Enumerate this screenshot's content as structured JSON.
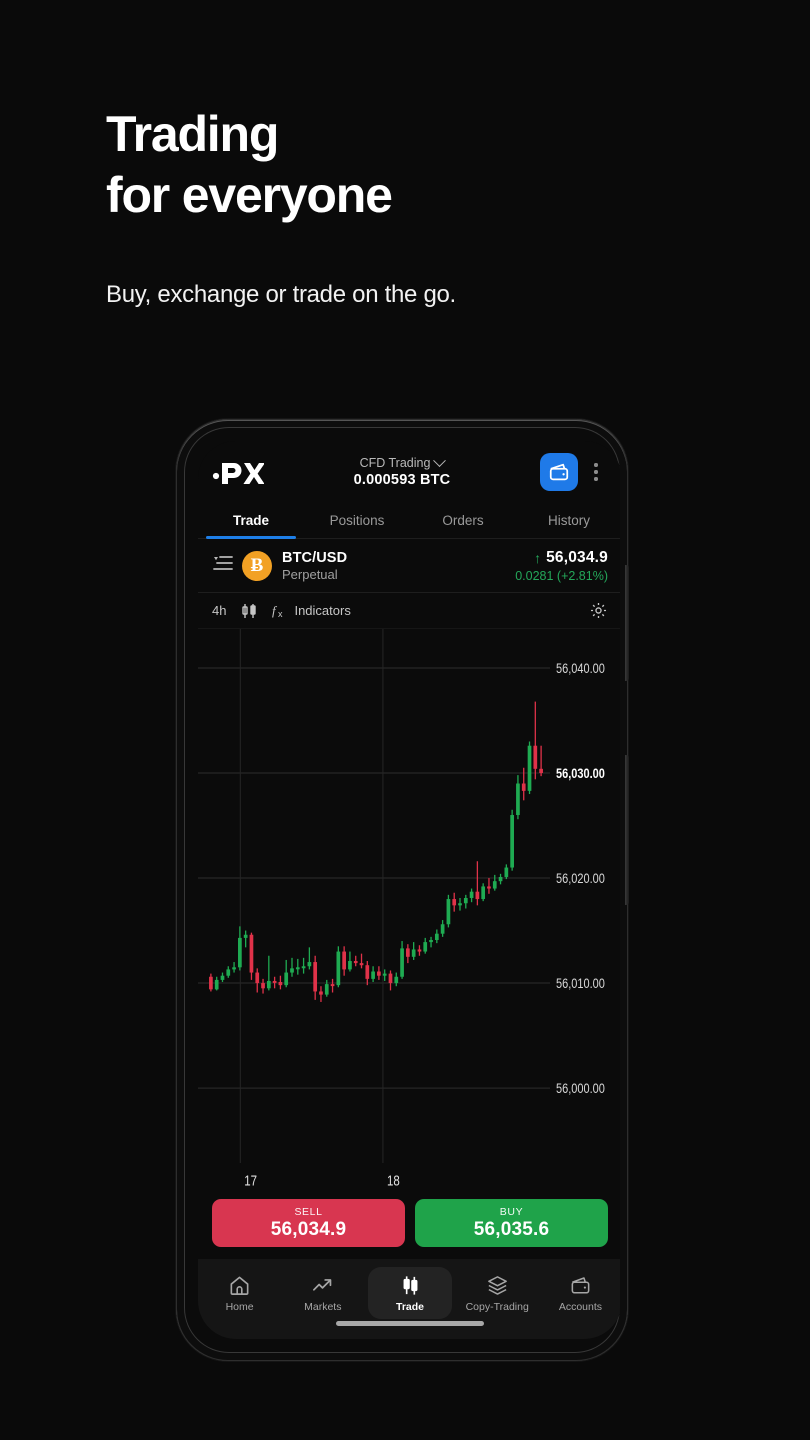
{
  "marketing": {
    "headline": "Trading\nfor everyone",
    "subhead": "Buy, exchange or trade on the go."
  },
  "app": {
    "header": {
      "logo": "px-logo",
      "account_type": "CFD Trading",
      "account_chevron": "chevron-down-icon",
      "balance": "0.000593 BTC",
      "wallet_icon": "wallet-icon",
      "wallet_color": "#1f7ae8",
      "menu_icon": "kebab-menu-icon"
    },
    "tabs": [
      {
        "label": "Trade",
        "active": true
      },
      {
        "label": "Positions",
        "active": false
      },
      {
        "label": "Orders",
        "active": false
      },
      {
        "label": "History",
        "active": false
      }
    ],
    "active_tab_color": "#1e7fe8",
    "instrument": {
      "list_icon": "filter-list-icon",
      "asset_icon": "bitcoin-icon",
      "asset_glyph": "Ƀ",
      "symbol": "BTC/USD",
      "contract": "Perpetual",
      "direction_icon": "arrow-up-icon",
      "price": "56,034.9",
      "change": "0.0281 (+2.81%)",
      "change_color": "#24a75a"
    },
    "chart_toolbar": {
      "timeframe": "4h",
      "chart_type_icon": "candlestick-icon",
      "indicators_icon": "function-fx-icon",
      "indicators_label": "Indicators",
      "settings_icon": "gear-icon"
    },
    "order_buttons": {
      "sell": {
        "label": "SELL",
        "price": "56,034.9",
        "color": "#d83650"
      },
      "buy": {
        "label": "BUY",
        "price": "56,035.6",
        "color": "#1fa34a"
      }
    },
    "bottom_nav": [
      {
        "label": "Home",
        "icon": "home-icon",
        "active": false
      },
      {
        "label": "Markets",
        "icon": "trend-up-icon",
        "active": false
      },
      {
        "label": "Trade",
        "icon": "candlestick-icon",
        "active": true
      },
      {
        "label": "Copy-Trading",
        "icon": "layers-icon",
        "active": false
      },
      {
        "label": "Accounts",
        "icon": "wallet-icon",
        "active": false
      }
    ],
    "home_indicator": "home-indicator-bar"
  },
  "chart_data": {
    "type": "candlestick",
    "title": "BTC/USD Perpetual",
    "timeframe": "4h",
    "xlabel": "",
    "ylabel": "",
    "ylim": [
      55995,
      56043
    ],
    "grid": true,
    "y_ticks": [
      "56,000.00",
      "56,010.00",
      "56,020.00",
      "56,030.00",
      "56,040.00"
    ],
    "y_tick_values": [
      56000,
      56010,
      56020,
      56030,
      56040
    ],
    "y_tick_highlight": "56,030.00",
    "x_ticks": [
      "17",
      "18"
    ],
    "x_tick_positions": [
      0.11,
      0.52
    ],
    "up_color": "#1fab52",
    "down_color": "#e03249",
    "candles": [
      {
        "o": 56010.6,
        "h": 56010.9,
        "l": 56009.2,
        "c": 56009.4
      },
      {
        "o": 56009.4,
        "h": 56010.6,
        "l": 56009.3,
        "c": 56010.3
      },
      {
        "o": 56010.3,
        "h": 56011.0,
        "l": 56010.1,
        "c": 56010.7
      },
      {
        "o": 56010.7,
        "h": 56011.6,
        "l": 56010.5,
        "c": 56011.3
      },
      {
        "o": 56011.3,
        "h": 56012.0,
        "l": 56011.0,
        "c": 56011.5
      },
      {
        "o": 56011.5,
        "h": 56015.4,
        "l": 56011.2,
        "c": 56014.3
      },
      {
        "o": 56014.3,
        "h": 56015.0,
        "l": 56013.4,
        "c": 56014.6
      },
      {
        "o": 56014.6,
        "h": 56014.8,
        "l": 56010.3,
        "c": 56011.0
      },
      {
        "o": 56011.0,
        "h": 56011.4,
        "l": 56009.1,
        "c": 56010.0
      },
      {
        "o": 56010.0,
        "h": 56010.4,
        "l": 56009.0,
        "c": 56009.5
      },
      {
        "o": 56009.5,
        "h": 56012.6,
        "l": 56009.3,
        "c": 56010.2
      },
      {
        "o": 56010.2,
        "h": 56010.6,
        "l": 56009.5,
        "c": 56010.1
      },
      {
        "o": 56010.1,
        "h": 56010.7,
        "l": 56009.4,
        "c": 56009.8
      },
      {
        "o": 56009.8,
        "h": 56012.2,
        "l": 56009.6,
        "c": 56011.0
      },
      {
        "o": 56011.0,
        "h": 56012.4,
        "l": 56010.6,
        "c": 56011.4
      },
      {
        "o": 56011.4,
        "h": 56012.3,
        "l": 56010.8,
        "c": 56011.5
      },
      {
        "o": 56011.5,
        "h": 56012.4,
        "l": 56010.9,
        "c": 56011.6
      },
      {
        "o": 56011.6,
        "h": 56013.4,
        "l": 56011.3,
        "c": 56012.0
      },
      {
        "o": 56012.0,
        "h": 56012.6,
        "l": 56008.4,
        "c": 56009.2
      },
      {
        "o": 56009.2,
        "h": 56009.7,
        "l": 56008.2,
        "c": 56008.9
      },
      {
        "o": 56008.9,
        "h": 56010.3,
        "l": 56008.7,
        "c": 56009.9
      },
      {
        "o": 56009.9,
        "h": 56010.4,
        "l": 56009.1,
        "c": 56009.8
      },
      {
        "o": 56009.8,
        "h": 56013.5,
        "l": 56009.6,
        "c": 56013.0
      },
      {
        "o": 56013.0,
        "h": 56013.5,
        "l": 56010.7,
        "c": 56011.3
      },
      {
        "o": 56011.3,
        "h": 56013.0,
        "l": 56011.1,
        "c": 56012.1
      },
      {
        "o": 56012.1,
        "h": 56012.6,
        "l": 56011.6,
        "c": 56011.9
      },
      {
        "o": 56011.9,
        "h": 56012.8,
        "l": 56011.4,
        "c": 56011.7
      },
      {
        "o": 56011.7,
        "h": 56012.1,
        "l": 56009.8,
        "c": 56010.4
      },
      {
        "o": 56010.4,
        "h": 56011.6,
        "l": 56010.1,
        "c": 56011.1
      },
      {
        "o": 56011.1,
        "h": 56011.6,
        "l": 56010.3,
        "c": 56010.7
      },
      {
        "o": 56010.7,
        "h": 56011.3,
        "l": 56010.2,
        "c": 56010.9
      },
      {
        "o": 56010.9,
        "h": 56011.2,
        "l": 56009.3,
        "c": 56010.0
      },
      {
        "o": 56010.0,
        "h": 56011.0,
        "l": 56009.7,
        "c": 56010.6
      },
      {
        "o": 56010.6,
        "h": 56014.0,
        "l": 56010.4,
        "c": 56013.3
      },
      {
        "o": 56013.3,
        "h": 56013.7,
        "l": 56011.9,
        "c": 56012.5
      },
      {
        "o": 56012.5,
        "h": 56013.9,
        "l": 56012.2,
        "c": 56013.2
      },
      {
        "o": 56013.2,
        "h": 56013.6,
        "l": 56012.6,
        "c": 56013.0
      },
      {
        "o": 56013.0,
        "h": 56014.3,
        "l": 56012.8,
        "c": 56013.9
      },
      {
        "o": 56013.9,
        "h": 56014.4,
        "l": 56013.4,
        "c": 56014.1
      },
      {
        "o": 56014.1,
        "h": 56015.1,
        "l": 56013.8,
        "c": 56014.7
      },
      {
        "o": 56014.7,
        "h": 56016.0,
        "l": 56014.4,
        "c": 56015.6
      },
      {
        "o": 56015.6,
        "h": 56018.4,
        "l": 56015.3,
        "c": 56018.0
      },
      {
        "o": 56018.0,
        "h": 56018.6,
        "l": 56016.8,
        "c": 56017.4
      },
      {
        "o": 56017.4,
        "h": 56018.1,
        "l": 56016.9,
        "c": 56017.6
      },
      {
        "o": 56017.6,
        "h": 56018.4,
        "l": 56017.1,
        "c": 56018.1
      },
      {
        "o": 56018.1,
        "h": 56019.0,
        "l": 56017.7,
        "c": 56018.7
      },
      {
        "o": 56018.7,
        "h": 56021.6,
        "l": 56017.4,
        "c": 56018.0
      },
      {
        "o": 56018.0,
        "h": 56019.5,
        "l": 56017.8,
        "c": 56019.2
      },
      {
        "o": 56019.2,
        "h": 56020.0,
        "l": 56018.5,
        "c": 56019.0
      },
      {
        "o": 56019.0,
        "h": 56020.3,
        "l": 56018.8,
        "c": 56019.7
      },
      {
        "o": 56019.7,
        "h": 56020.4,
        "l": 56019.4,
        "c": 56020.1
      },
      {
        "o": 56020.1,
        "h": 56021.3,
        "l": 56019.9,
        "c": 56021.0
      },
      {
        "o": 56021.0,
        "h": 56026.5,
        "l": 56020.7,
        "c": 56026.0
      },
      {
        "o": 56026.0,
        "h": 56029.8,
        "l": 56025.6,
        "c": 56029.0
      },
      {
        "o": 56029.0,
        "h": 56030.5,
        "l": 56027.4,
        "c": 56028.3
      },
      {
        "o": 56028.3,
        "h": 56033.0,
        "l": 56028.0,
        "c": 56032.6
      },
      {
        "o": 56032.6,
        "h": 56036.8,
        "l": 56029.4,
        "c": 56030.4
      },
      {
        "o": 56030.4,
        "h": 56032.6,
        "l": 56029.7,
        "c": 56030.0
      }
    ]
  }
}
